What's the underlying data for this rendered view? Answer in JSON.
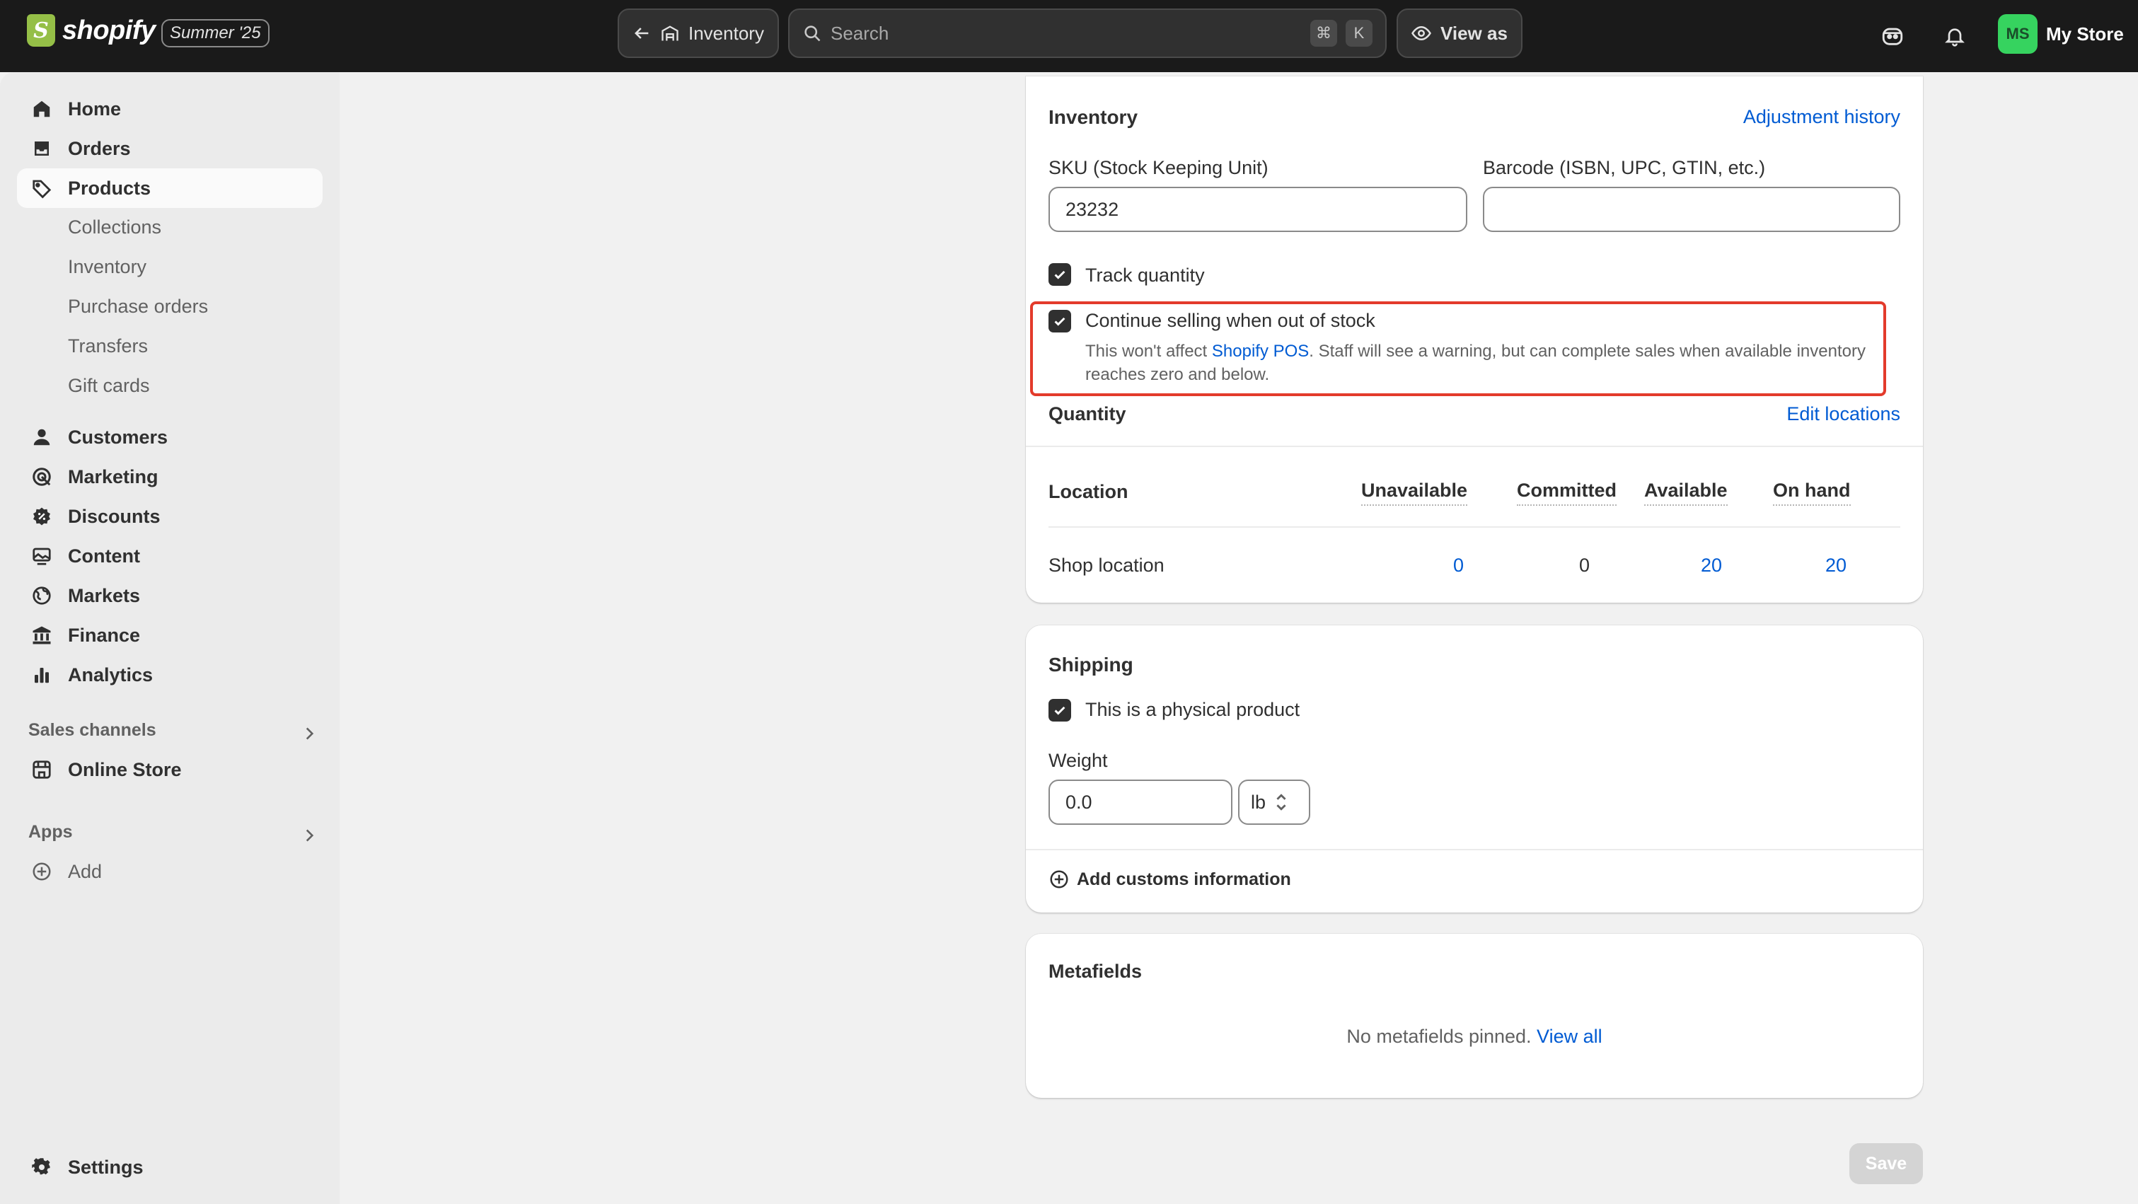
{
  "topbar": {
    "brand": "shopify",
    "edition": "Summer '25",
    "back_label": "Inventory",
    "search_placeholder": "Search",
    "shortcut_cmd": "⌘",
    "shortcut_key": "K",
    "view_as": "View as",
    "avatar_initials": "MS",
    "store_name": "My Store"
  },
  "sidebar": {
    "items": [
      {
        "label": "Home",
        "icon": "home-icon"
      },
      {
        "label": "Orders",
        "icon": "inbox-icon"
      },
      {
        "label": "Products",
        "icon": "tag-icon",
        "active": true
      },
      {
        "label": "Customers",
        "icon": "person-icon"
      },
      {
        "label": "Marketing",
        "icon": "target-icon"
      },
      {
        "label": "Discounts",
        "icon": "discount-icon"
      },
      {
        "label": "Content",
        "icon": "image-icon"
      },
      {
        "label": "Markets",
        "icon": "globe-icon"
      },
      {
        "label": "Finance",
        "icon": "bank-icon"
      },
      {
        "label": "Analytics",
        "icon": "bar-chart-icon"
      }
    ],
    "product_subitems": [
      "Collections",
      "Inventory",
      "Purchase orders",
      "Transfers",
      "Gift cards"
    ],
    "sales_channels_label": "Sales channels",
    "online_store": "Online Store",
    "apps_label": "Apps",
    "add_label": "Add",
    "settings_label": "Settings"
  },
  "inventory": {
    "title": "Inventory",
    "adjustment_history": "Adjustment history",
    "sku_label": "SKU (Stock Keeping Unit)",
    "sku_value": "23232",
    "barcode_label": "Barcode (ISBN, UPC, GTIN, etc.)",
    "barcode_value": "",
    "track_quantity": "Track quantity",
    "continue_selling": "Continue selling when out of stock",
    "help_prefix": "This won't affect ",
    "help_link": "Shopify POS",
    "help_suffix": ". Staff will see a warning, but can complete sales when available inventory reaches zero and below.",
    "quantity_title": "Quantity",
    "edit_locations": "Edit locations",
    "table": {
      "headers": [
        "Location",
        "Unavailable",
        "Committed",
        "Available",
        "On hand"
      ],
      "rows": [
        {
          "location": "Shop location",
          "unavailable": "0",
          "committed": "0",
          "available": "20",
          "on_hand": "20"
        }
      ]
    }
  },
  "shipping": {
    "title": "Shipping",
    "physical_product": "This is a physical product",
    "weight_label": "Weight",
    "weight_value": "0.0",
    "weight_unit": "lb",
    "customs": "Add customs information"
  },
  "metafields": {
    "title": "Metafields",
    "empty_text": "No metafields pinned.",
    "view_all": "View all"
  },
  "save_label": "Save",
  "colors": {
    "accent_link": "#005bd3",
    "highlight": "#e33b2b",
    "topbar": "#1a1a1a",
    "avatar": "#36d35f"
  }
}
